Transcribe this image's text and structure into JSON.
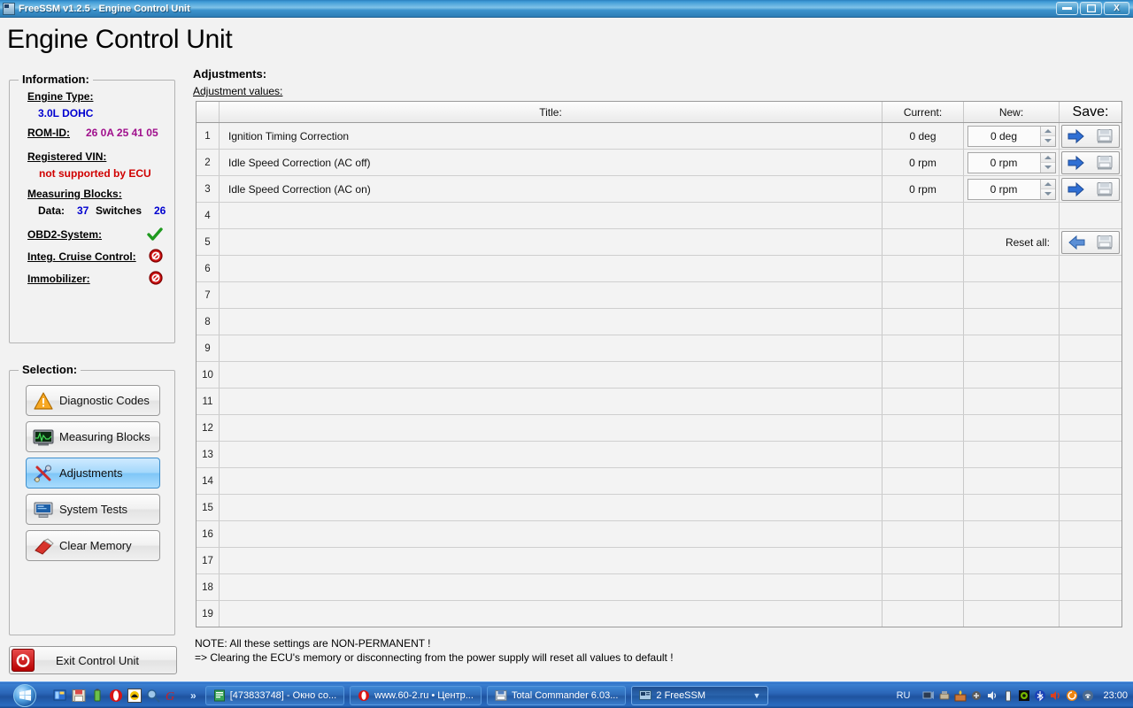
{
  "window": {
    "title": "FreeSSM v1.2.5 - Engine Control Unit",
    "minimize_label": "–",
    "maximize_label": "❐",
    "close_label": "X"
  },
  "page": {
    "heading": "Engine Control Unit"
  },
  "information": {
    "group_title": "Information:",
    "engine_type_label": "Engine Type:",
    "engine_type_value": "3.0L DOHC",
    "rom_id_label": "ROM-ID:",
    "rom_id_value": "26 0A 25 41 05",
    "vin_label": "Registered VIN:",
    "vin_value": "not supported by ECU",
    "measuring_blocks_label": "Measuring Blocks:",
    "data_label": "Data:",
    "data_value": "37",
    "switches_label": "Switches",
    "switches_value": "26",
    "obd2_label": "OBD2-System:",
    "obd2_status": "supported",
    "cruise_label": "Integ. Cruise Control:",
    "cruise_status": "not-supported",
    "immobilizer_label": "Immobilizer:",
    "immobilizer_status": "not-supported"
  },
  "selection": {
    "group_title": "Selection:",
    "items": [
      {
        "label": "Diagnostic Codes",
        "icon": "warning-triangle-icon",
        "active": false
      },
      {
        "label": "Measuring Blocks",
        "icon": "oscilloscope-icon",
        "active": false
      },
      {
        "label": "Adjustments",
        "icon": "tools-icon",
        "active": true
      },
      {
        "label": "System Tests",
        "icon": "monitor-icon",
        "active": false
      },
      {
        "label": "Clear Memory",
        "icon": "eraser-icon",
        "active": false
      }
    ]
  },
  "exit": {
    "label": "Exit Control Unit",
    "icon": "power-icon"
  },
  "adjustments": {
    "group_title": "Adjustments:",
    "caption": "Adjustment values:",
    "columns": {
      "num": "",
      "title": "Title:",
      "current": "Current:",
      "new": "New:",
      "save": "Save:"
    },
    "reset_all_label": "Reset all:",
    "reset_all_row": 5,
    "rows": [
      {
        "num": "1",
        "title": "Ignition Timing Correction",
        "current": "0 deg",
        "new": "0 deg",
        "has_controls": true
      },
      {
        "num": "2",
        "title": "Idle Speed Correction (AC off)",
        "current": "0 rpm",
        "new": "0 rpm",
        "has_controls": true
      },
      {
        "num": "3",
        "title": "Idle Speed Correction (AC on)",
        "current": "0 rpm",
        "new": "0 rpm",
        "has_controls": true
      },
      {
        "num": "4",
        "title": "",
        "current": "",
        "new": "",
        "has_controls": false
      },
      {
        "num": "5",
        "title": "",
        "current": "",
        "new": "",
        "has_controls": false
      },
      {
        "num": "6",
        "title": "",
        "current": "",
        "new": "",
        "has_controls": false
      },
      {
        "num": "7",
        "title": "",
        "current": "",
        "new": "",
        "has_controls": false
      },
      {
        "num": "8",
        "title": "",
        "current": "",
        "new": "",
        "has_controls": false
      },
      {
        "num": "9",
        "title": "",
        "current": "",
        "new": "",
        "has_controls": false
      },
      {
        "num": "10",
        "title": "",
        "current": "",
        "new": "",
        "has_controls": false
      },
      {
        "num": "11",
        "title": "",
        "current": "",
        "new": "",
        "has_controls": false
      },
      {
        "num": "12",
        "title": "",
        "current": "",
        "new": "",
        "has_controls": false
      },
      {
        "num": "13",
        "title": "",
        "current": "",
        "new": "",
        "has_controls": false
      },
      {
        "num": "14",
        "title": "",
        "current": "",
        "new": "",
        "has_controls": false
      },
      {
        "num": "15",
        "title": "",
        "current": "",
        "new": "",
        "has_controls": false
      },
      {
        "num": "16",
        "title": "",
        "current": "",
        "new": "",
        "has_controls": false
      },
      {
        "num": "17",
        "title": "",
        "current": "",
        "new": "",
        "has_controls": false
      },
      {
        "num": "18",
        "title": "",
        "current": "",
        "new": "",
        "has_controls": false
      },
      {
        "num": "19",
        "title": "",
        "current": "",
        "new": "",
        "has_controls": false
      }
    ],
    "note_line1": "NOTE:  All these settings are NON-PERMANENT !",
    "note_line2": "=> Clearing the ECU's memory or disconnecting from the power supply will reset all values to default !"
  },
  "taskbar": {
    "start_label": "",
    "quicklaunch": [
      {
        "name": "show-desktop-icon"
      },
      {
        "name": "floppy-save-icon"
      },
      {
        "name": "battery-icon"
      },
      {
        "name": "opera-icon"
      },
      {
        "name": "winamp-icon"
      },
      {
        "name": "search-icon"
      },
      {
        "name": "getright-icon"
      }
    ],
    "overflow_label": "»",
    "tasks": [
      {
        "label": "[473833748] - Окно со...",
        "icon": "notepad-icon",
        "active": false
      },
      {
        "label": "www.60-2.ru • Центр...",
        "icon": "opera-icon",
        "active": false
      },
      {
        "label": "Total Commander 6.03...",
        "icon": "totalcmd-icon",
        "active": false
      },
      {
        "label": "2 FreeSSM",
        "icon": "freessm-icon",
        "active": true
      }
    ],
    "language": "RU",
    "tray_icons": [
      "network-icon",
      "usb-icon",
      "firewall-icon",
      "antivirus-icon",
      "volume-small-icon",
      "battery-tray-icon",
      "nvidia-icon",
      "bluetooth-icon",
      "speaker-icon",
      "update-icon",
      "wireless-icon"
    ],
    "clock": "23:00"
  },
  "colors": {
    "accent": "#0000d0",
    "rom": "#a0108c",
    "warn": "#d00000",
    "ok": "#1f9a1f",
    "titlebar": "#2f80bd"
  }
}
